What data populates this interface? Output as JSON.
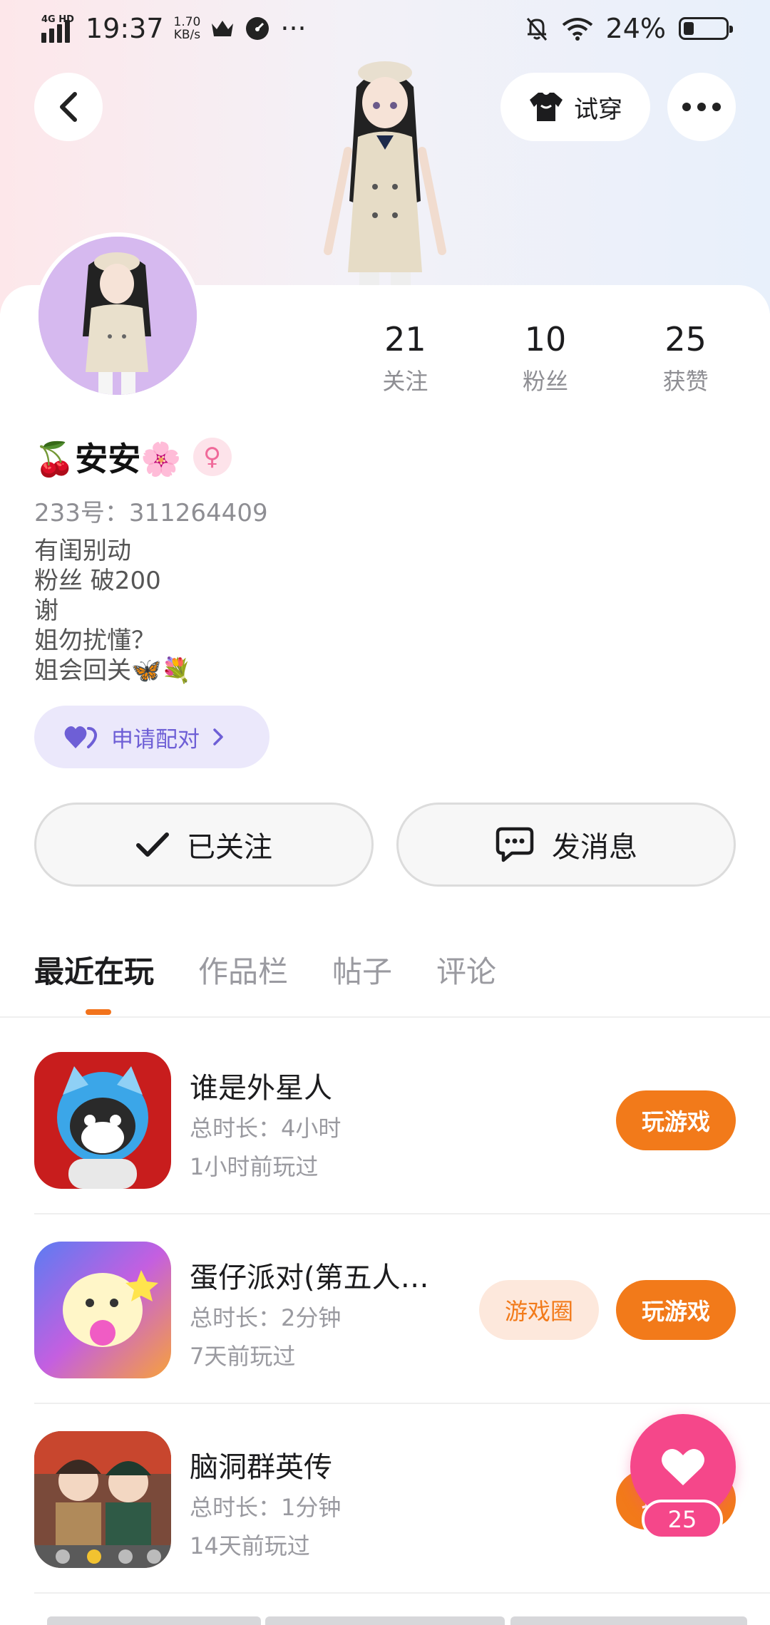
{
  "status_bar": {
    "network": "4G HD",
    "time": "19:37",
    "speed_value": "1.70",
    "speed_unit": "KB/s",
    "more": "···",
    "battery_percent": "24%",
    "battery_level": 0.24
  },
  "header": {
    "try_on_label": "试穿"
  },
  "profile": {
    "name": "🍒安安🌸",
    "gender_symbol": "♀",
    "uid": "233号：311264409",
    "bio_lines": [
      "有闺别动",
      "粉丝 破200",
      "谢",
      "姐勿扰懂？",
      "姐会回关🦋💐"
    ],
    "pair_label": "申请配对"
  },
  "stats": [
    {
      "value": "21",
      "label": "关注"
    },
    {
      "value": "10",
      "label": "粉丝"
    },
    {
      "value": "25",
      "label": "获赞"
    }
  ],
  "actions": {
    "follow_label": "已关注",
    "message_label": "发消息"
  },
  "tabs": [
    {
      "label": "最近在玩",
      "active": true
    },
    {
      "label": "作品栏",
      "active": false
    },
    {
      "label": "帖子",
      "active": false
    },
    {
      "label": "评论",
      "active": false
    }
  ],
  "games": [
    {
      "title": "谁是外星人",
      "duration": "总时长：4小时",
      "last_played": "1小时前玩过",
      "play_label": "玩游戏"
    },
    {
      "title": "蛋仔派对(第五人…",
      "duration": "总时长：2分钟",
      "last_played": "7天前玩过",
      "play_label": "玩游戏",
      "circle_label": "游戏圈"
    },
    {
      "title": "脑洞群英传",
      "duration": "总时长：1分钟",
      "last_played": "14天前玩过",
      "play_label": "玩游戏"
    }
  ],
  "like_fab": {
    "count": "25"
  },
  "colors": {
    "accent": "#f27a1a",
    "like": "#f5478a",
    "pair": "#6e5fd6"
  }
}
